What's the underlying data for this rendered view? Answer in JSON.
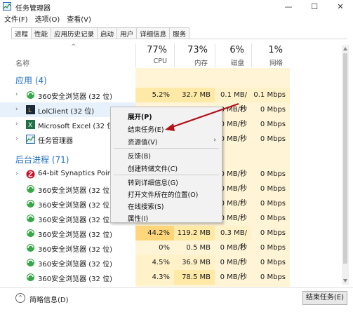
{
  "window": {
    "title": "任务管理器",
    "min_label": "—",
    "max_label": "☐",
    "close_label": "✕"
  },
  "menubar": [
    "文件(F)",
    "选项(O)",
    "查看(V)"
  ],
  "tabs": [
    "进程",
    "性能",
    "应用历史记录",
    "启动",
    "用户",
    "详细信息",
    "服务"
  ],
  "columns": {
    "name": "名称",
    "sort_indicator": "^",
    "cpu": {
      "pct": "77%",
      "label": "CPU"
    },
    "mem": {
      "pct": "73%",
      "label": "内存"
    },
    "disk": {
      "pct": "6%",
      "label": "磁盘"
    },
    "net": {
      "pct": "1%",
      "label": "网络"
    }
  },
  "sections": {
    "apps": "应用 (4)",
    "background": "后台进程 (71)"
  },
  "rows": [
    {
      "name": "360安全浏览器 (32 位)",
      "icon": "browser-icon",
      "chev": "›",
      "cpu": "5.2%",
      "mem": "32.7 MB",
      "disk": "0.1 MB/秒",
      "net": "0.1 Mbps"
    },
    {
      "name": "LolClient (32 位)",
      "icon": "lol-icon",
      "chev": "›",
      "cpu": "",
      "mem": "",
      "disk": "0 MB/秒",
      "net": "0 Mbps"
    },
    {
      "name": "Microsoft Excel (32 位)",
      "icon": "excel-icon",
      "chev": "›",
      "cpu": "",
      "mem": "",
      "disk": "0 MB/秒",
      "net": "0 Mbps"
    },
    {
      "name": "任务管理器",
      "icon": "taskmgr-icon",
      "chev": "›",
      "cpu": "",
      "mem": "",
      "disk": "0 MB/秒",
      "net": "0 Mbps"
    },
    {
      "name": "64-bit Synaptics Pointin",
      "icon": "synaptics-icon",
      "chev": "›",
      "cpu": "",
      "mem": "",
      "disk": "0 MB/秒",
      "net": "0 Mbps"
    },
    {
      "name": "360安全浏览器 (32 位)",
      "icon": "browser-icon",
      "chev": "",
      "cpu": "",
      "mem": "",
      "disk": "0 MB/秒",
      "net": "0 Mbps"
    },
    {
      "name": "360安全浏览器 (32 位)",
      "icon": "browser-icon",
      "chev": "",
      "cpu": "",
      "mem": "",
      "disk": "0 MB/秒",
      "net": "0 Mbps"
    },
    {
      "name": "360安全浏览器 (32 位)",
      "icon": "browser-icon",
      "chev": "",
      "cpu": "",
      "mem": "",
      "disk": "0 MB/秒",
      "net": "0 Mbps"
    },
    {
      "name": "360安全浏览器 (32 位)",
      "icon": "browser-icon",
      "chev": "",
      "cpu": "44.2%",
      "mem": "119.2 MB",
      "disk": "0.3 MB/秒",
      "net": "0 Mbps"
    },
    {
      "name": "360安全浏览器 (32 位)",
      "icon": "browser-icon",
      "chev": "",
      "cpu": "0%",
      "mem": "0.5 MB",
      "disk": "0 MB/秒",
      "net": "0 Mbps"
    },
    {
      "name": "360安全浏览器 (32 位)",
      "icon": "browser-icon",
      "chev": "",
      "cpu": "4.5%",
      "mem": "36.9 MB",
      "disk": "0 MB/秒",
      "net": "0 Mbps"
    },
    {
      "name": "360安全浏览器 (32 位)",
      "icon": "browser-icon",
      "chev": "",
      "cpu": "4.3%",
      "mem": "78.5 MB",
      "disk": "0 MB/秒",
      "net": "0 Mbps"
    }
  ],
  "context_menu": {
    "expand": "展开(P)",
    "end_task": "结束任务(E)",
    "resource_values": "资源值(V)",
    "feedback": "反馈(B)",
    "create_dump": "创建转储文件(C)",
    "go_to_details": "转到详细信息(G)",
    "open_file_location": "打开文件所在的位置(O)",
    "search_online": "在线搜索(S)",
    "properties": "属性(I)",
    "submenu_arrow": "›"
  },
  "bottom": {
    "fewer_details": "简略信息(D)",
    "end_task_button": "结束任务(E)",
    "collapse_glyph": "⌃"
  },
  "colors": {
    "accent": "#1f6fc2",
    "heat_light": "#fff4d6",
    "heat_high": "#ffd77a",
    "arrow": "#b3121a"
  }
}
